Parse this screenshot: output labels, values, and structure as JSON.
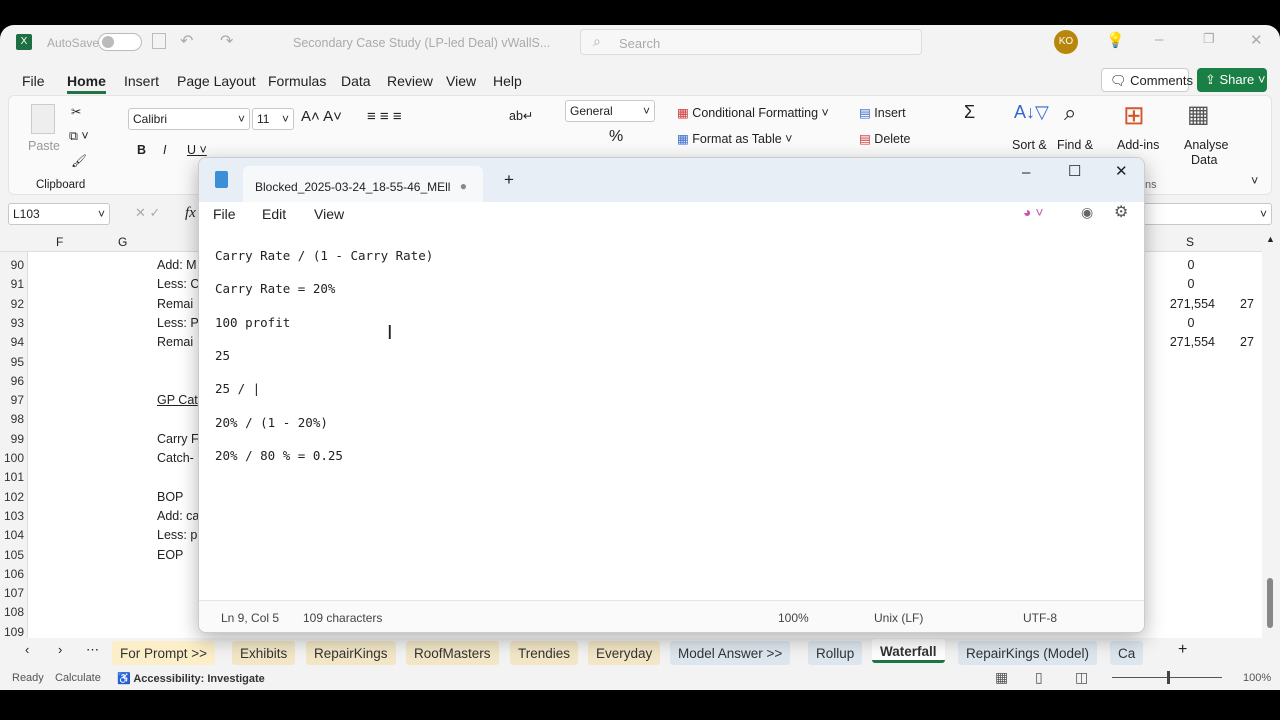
{
  "excel": {
    "autosave": "AutoSave",
    "doc_title": "Secondary Case Study (LP-led Deal) vWallS...",
    "search_placeholder": "Search",
    "avatar": "KO",
    "menu": [
      "File",
      "Home",
      "Insert",
      "Page Layout",
      "Formulas",
      "Data",
      "Review",
      "View",
      "Help"
    ],
    "comments": "Comments",
    "share": "Share",
    "ribbon": {
      "paste": "Paste",
      "clipboard": "Clipboard",
      "font": "Calibri",
      "size": "11",
      "number_format": "General",
      "conditional": "Conditional Formatting",
      "format_table": "Format as Table",
      "insert": "Insert",
      "delete": "Delete",
      "sort": "Sort &",
      "find": "Find &",
      "addins": "Add-ins",
      "analyse": "Analyse",
      "analyse2": "Data",
      "ns": "ns"
    },
    "name_box": "L103",
    "fx": "fx",
    "columns": [
      "F",
      "G",
      "S"
    ],
    "rows": [
      {
        "n": "90",
        "label": "Add: M",
        "s": "0",
        "t": ""
      },
      {
        "n": "91",
        "label": "Less: C",
        "s": "0",
        "t": ""
      },
      {
        "n": "92",
        "label": "Remai",
        "s": "271,554",
        "t": "27"
      },
      {
        "n": "93",
        "label": "Less: P",
        "s": "0",
        "t": ""
      },
      {
        "n": "94",
        "label": "Remai",
        "s": "271,554",
        "t": "27"
      },
      {
        "n": "95",
        "label": "",
        "s": "",
        "t": ""
      },
      {
        "n": "96",
        "label": "",
        "s": "",
        "t": ""
      },
      {
        "n": "97",
        "label": "GP Cat",
        "s": "",
        "t": ""
      },
      {
        "n": "98",
        "label": "",
        "s": "",
        "t": ""
      },
      {
        "n": "99",
        "label": "Carry F",
        "s": "",
        "t": ""
      },
      {
        "n": "100",
        "label": "Catch-",
        "s": "",
        "t": ""
      },
      {
        "n": "101",
        "label": "",
        "s": "",
        "t": ""
      },
      {
        "n": "102",
        "label": "BOP",
        "s": "",
        "t": ""
      },
      {
        "n": "103",
        "label": "Add: ca",
        "s": "",
        "t": ""
      },
      {
        "n": "104",
        "label": "Less: p",
        "s": "",
        "t": ""
      },
      {
        "n": "105",
        "label": "EOP",
        "s": "",
        "t": ""
      },
      {
        "n": "106",
        "label": "",
        "s": "",
        "t": ""
      },
      {
        "n": "107",
        "label": "",
        "s": "",
        "t": ""
      },
      {
        "n": "108",
        "label": "",
        "s": "",
        "t": ""
      },
      {
        "n": "109",
        "label": "",
        "s": "",
        "t": ""
      }
    ],
    "sheet_tabs": [
      "For Prompt >>",
      "Exhibits",
      "RepairKings",
      "RoofMasters",
      "Trendies",
      "Everyday",
      "Model Answer >>",
      "Rollup",
      "Waterfall",
      "RepairKings (Model)",
      "Ca"
    ],
    "active_tab": "Waterfall",
    "status": {
      "ready": "Ready",
      "calculate": "Calculate",
      "accessibility": "Accessibility: Investigate",
      "zoom": "100%"
    }
  },
  "notepad": {
    "tab_title": "Blocked_2025-03-24_18-55-46_MEll",
    "menu": [
      "File",
      "Edit",
      "View"
    ],
    "lines": [
      "Carry Rate / (1 - Carry Rate)",
      "Carry Rate = 20%",
      "100 profit",
      "25",
      "25 / |",
      "20% / (1 - 20%)",
      "20% / 80 % = 0.25"
    ],
    "status": {
      "position": "Ln 9, Col 5",
      "chars": "109 characters",
      "zoom": "100%",
      "eol": "Unix (LF)",
      "encoding": "UTF-8"
    }
  },
  "colors": {
    "excel_green": "#217346",
    "share": "#1a7f45"
  }
}
